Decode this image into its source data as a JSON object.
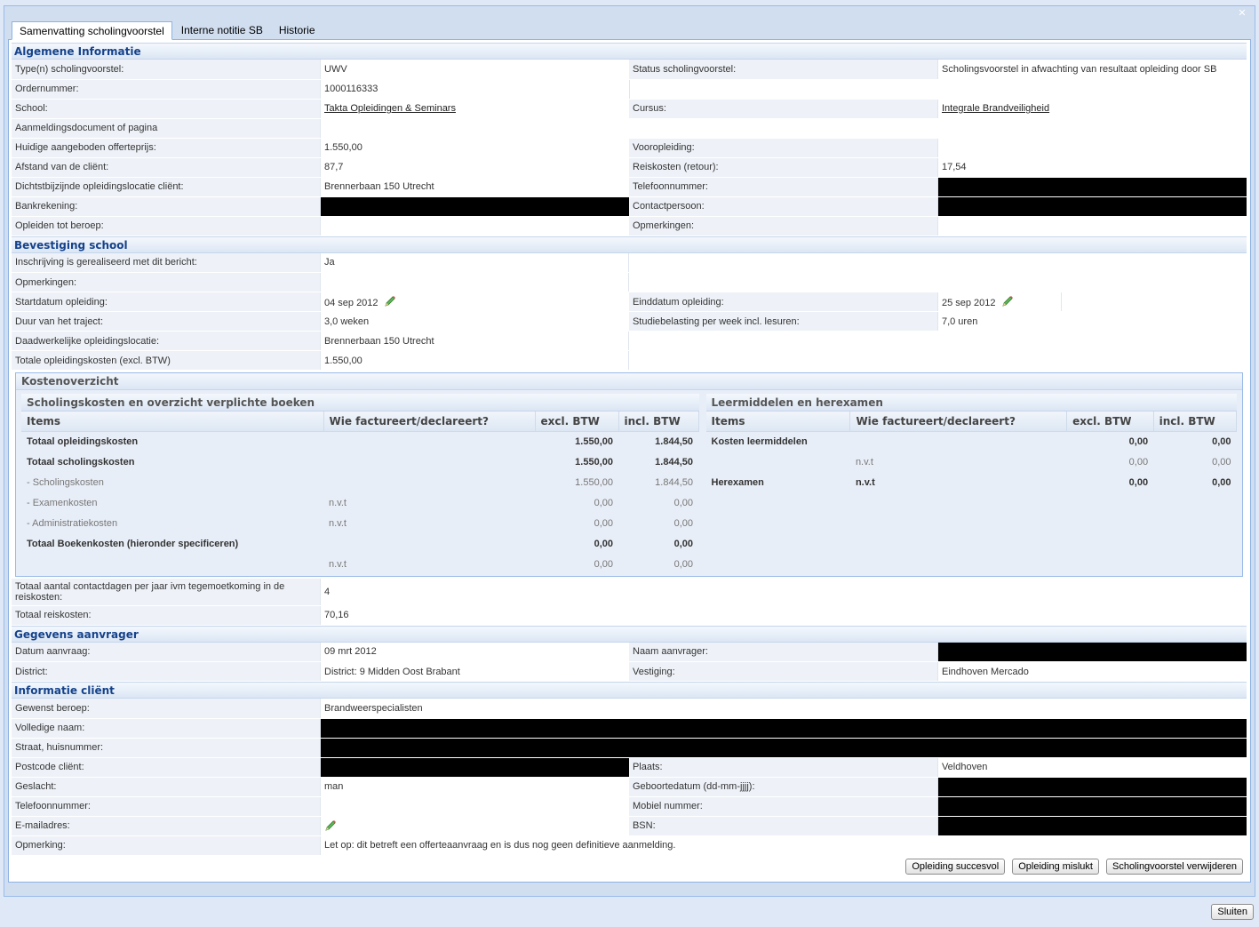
{
  "window": {
    "close_icon": "close-icon"
  },
  "tabs": [
    {
      "label": "Samenvatting scholingvoorstel",
      "active": true
    },
    {
      "label": "Interne notitie SB",
      "active": false
    },
    {
      "label": "Historie",
      "active": false
    }
  ],
  "algemeen": {
    "title": "Algemene Informatie",
    "type_label": "Type(n) scholingvoorstel:",
    "type_value": "UWV",
    "status_label": "Status scholingvoorstel:",
    "status_value": "Scholingsvoorstel in afwachting van resultaat opleiding door SB",
    "order_label": "Ordernummer:",
    "order_value": "1000116333",
    "school_label": "School:",
    "school_value": "Takta Opleidingen & Seminars",
    "cursus_label": "Cursus:",
    "cursus_value": "Integrale Brandveiligheid",
    "aanmelding_label": "Aanmeldingsdocument of pagina",
    "offerte_label": "Huidige aangeboden offerteprijs:",
    "offerte_value": "1.550,00",
    "vooropleiding_label": "Vooropleiding:",
    "afstand_label": "Afstand van de cliënt:",
    "afstand_value": "87,7",
    "reiskosten_label": "Reiskosten (retour):",
    "reiskosten_value": "17,54",
    "locatie_label": "Dichtstbijzijnde opleidingslocatie cliënt:",
    "locatie_value": "Brennerbaan 150 Utrecht",
    "telefoon_label": "Telefoonnummer:",
    "bank_label": "Bankrekening:",
    "contact_label": "Contactpersoon:",
    "beroep_label": "Opleiden tot beroep:",
    "opmerkingen_label": "Opmerkingen:"
  },
  "bevestiging": {
    "title": "Bevestiging school",
    "inschrijving_label": "Inschrijving is gerealiseerd met dit bericht:",
    "inschrijving_value": "Ja",
    "opmerkingen_label": "Opmerkingen:",
    "start_label": "Startdatum opleiding:",
    "start_value": "04 sep 2012",
    "eind_label": "Einddatum opleiding:",
    "eind_value": "25 sep 2012",
    "duur_label": "Duur van het traject:",
    "duur_value": "3,0 weken",
    "studie_label": "Studiebelasting per week incl. lesuren:",
    "studie_value": "7,0 uren",
    "daadwerkelijk_label": "Daadwerkelijke opleidingslocatie:",
    "daadwerkelijk_value": "Brennerbaan 150 Utrecht",
    "totaal_label": "Totale opleidingskosten (excl. BTW)",
    "totaal_value": "1.550,00"
  },
  "kosten": {
    "title": "Kostenoverzicht",
    "left": {
      "title": "Scholingskosten en overzicht verplichte boeken",
      "headers": [
        "Items",
        "Wie factureert/declareert?",
        "excl. BTW",
        "incl. BTW"
      ],
      "rows": [
        {
          "item": "Totaal opleidingskosten",
          "wie": "",
          "excl": "1.550,00",
          "incl": "1.844,50",
          "bold": true
        },
        {
          "item": "Totaal scholingskosten",
          "wie": "",
          "excl": "1.550,00",
          "incl": "1.844,50",
          "bold": true
        },
        {
          "item": "- Scholingskosten",
          "wie": "",
          "excl": "1.550,00",
          "incl": "1.844,50",
          "bold": false
        },
        {
          "item": "- Examenkosten",
          "wie": "n.v.t",
          "excl": "0,00",
          "incl": "0,00",
          "bold": false
        },
        {
          "item": "- Administratiekosten",
          "wie": "n.v.t",
          "excl": "0,00",
          "incl": "0,00",
          "bold": false
        },
        {
          "item": "Totaal Boekenkosten (hieronder specificeren)",
          "wie": "",
          "excl": "0,00",
          "incl": "0,00",
          "bold": true
        },
        {
          "item": "",
          "wie": "n.v.t",
          "excl": "0,00",
          "incl": "0,00",
          "bold": false
        }
      ]
    },
    "right": {
      "title": "Leermiddelen en herexamen",
      "headers": [
        "Items",
        "Wie factureert/declareert?",
        "excl. BTW",
        "incl. BTW"
      ],
      "rows": [
        {
          "item": "Kosten leermiddelen",
          "wie": "",
          "excl": "0,00",
          "incl": "0,00",
          "bold": true
        },
        {
          "item": "",
          "wie": "n.v.t",
          "excl": "0,00",
          "incl": "0,00",
          "bold": false
        },
        {
          "item": "Herexamen",
          "wie": "n.v.t",
          "excl": "0,00",
          "incl": "0,00",
          "bold": true
        }
      ]
    }
  },
  "contactdagen": {
    "label": "Totaal aantal contactdagen per jaar ivm tegemoetkoming in de reiskosten:",
    "value": "4",
    "reis_label": "Totaal reiskosten:",
    "reis_value": "70,16"
  },
  "aanvrager": {
    "title": "Gegevens aanvrager",
    "datum_label": "Datum aanvraag:",
    "datum_value": "09 mrt 2012",
    "naam_label": "Naam aanvrager:",
    "district_label": "District:",
    "district_value": "District: 9 Midden Oost Brabant",
    "vestiging_label": "Vestiging:",
    "vestiging_value": "Eindhoven Mercado"
  },
  "client": {
    "title": "Informatie cliënt",
    "beroep_label": "Gewenst beroep:",
    "beroep_value": "Brandweerspecialisten",
    "naam_label": "Volledige naam:",
    "straat_label": "Straat, huisnummer:",
    "postcode_label": "Postcode cliënt:",
    "plaats_label": "Plaats:",
    "plaats_value": "Veldhoven",
    "geslacht_label": "Geslacht:",
    "geslacht_value": "man",
    "geboorte_label": "Geboortedatum (dd-mm-jjjj):",
    "telefoon_label": "Telefoonnummer:",
    "mobiel_label": "Mobiel nummer:",
    "email_label": "E-mailadres:",
    "bsn_label": "BSN:",
    "opmerking_label": "Opmerking:",
    "opmerking_value": "Let op: dit betreft een offerteaanvraag en is dus nog geen definitieve aanmelding."
  },
  "buttons": {
    "succes": "Opleiding succesvol",
    "mislukt": "Opleiding mislukt",
    "verwijderen": "Scholingvoorstel verwijderen",
    "sluiten": "Sluiten"
  }
}
